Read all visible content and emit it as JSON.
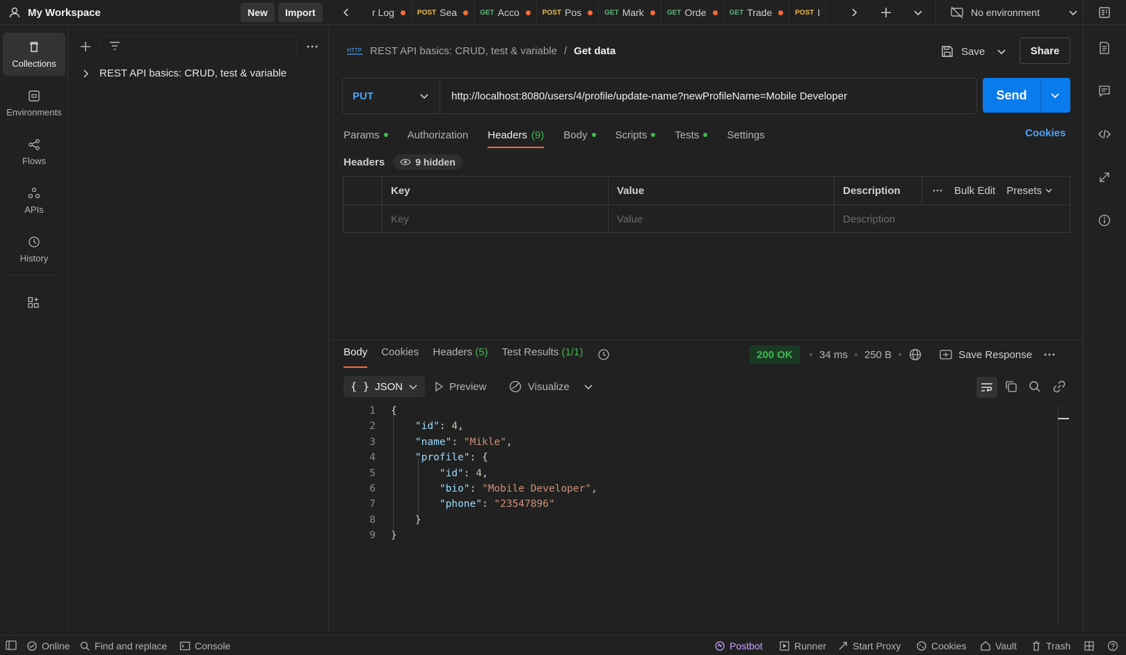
{
  "workspace": {
    "title": "My Workspace",
    "new_label": "New",
    "import_label": "Import"
  },
  "tabs": [
    {
      "method": "",
      "label": "r Log",
      "kind": "post"
    },
    {
      "method": "POST",
      "label": "Sea",
      "kind": "post"
    },
    {
      "method": "GET",
      "label": "Acco",
      "kind": "get"
    },
    {
      "method": "POST",
      "label": "Pos",
      "kind": "post"
    },
    {
      "method": "GET",
      "label": "Mark",
      "kind": "get"
    },
    {
      "method": "GET",
      "label": "Orde",
      "kind": "get"
    },
    {
      "method": "GET",
      "label": "Trade",
      "kind": "get"
    },
    {
      "method": "POST",
      "label": "I",
      "kind": "post"
    }
  ],
  "environment": {
    "label": "No environment"
  },
  "nav": [
    {
      "label": "Collections",
      "icon": "trash-can-icon"
    },
    {
      "label": "Environments",
      "icon": "environment-icon"
    },
    {
      "label": "Flows",
      "icon": "flows-icon"
    },
    {
      "label": "APIs",
      "icon": "apis-icon"
    },
    {
      "label": "History",
      "icon": "history-icon"
    }
  ],
  "sidebar": {
    "collection": "REST API basics: CRUD, test & variable"
  },
  "request": {
    "breadcrumb_parent": "REST API basics: CRUD, test & variable",
    "breadcrumb_sep": "/",
    "name": "Get data",
    "save_label": "Save",
    "share_label": "Share",
    "method": "PUT",
    "url": "http://localhost:8080/users/4/profile/update-name?newProfileName=Mobile Developer",
    "send_label": "Send",
    "tabs": {
      "params": "Params",
      "authorization": "Authorization",
      "headers": "Headers",
      "headers_count": "(9)",
      "body": "Body",
      "scripts": "Scripts",
      "tests": "Tests",
      "settings": "Settings",
      "cookies": "Cookies"
    },
    "headers_section": {
      "title": "Headers",
      "hidden": "9 hidden",
      "col_key": "Key",
      "col_value": "Value",
      "col_description": "Description",
      "bulk_edit": "Bulk Edit",
      "presets": "Presets",
      "ph_key": "Key",
      "ph_value": "Value",
      "ph_description": "Description"
    }
  },
  "response": {
    "tabs": {
      "body": "Body",
      "cookies": "Cookies",
      "headers": "Headers",
      "headers_count": "(5)",
      "test_results": "Test Results",
      "test_count": "(1/1)"
    },
    "status": "200 OK",
    "time": "34 ms",
    "size": "250 B",
    "save_response": "Save Response",
    "format": "JSON",
    "preview": "Preview",
    "visualize": "Visualize",
    "lines": [
      "1",
      "2",
      "3",
      "4",
      "5",
      "6",
      "7",
      "8",
      "9"
    ],
    "body": {
      "id_key": "\"id\"",
      "id_val": "4",
      "name_key": "\"name\"",
      "name_val": "\"Mikle\"",
      "profile_key": "\"profile\"",
      "p_id_key": "\"id\"",
      "p_id_val": "4",
      "bio_key": "\"bio\"",
      "bio_val": "\"Mobile Developer\"",
      "phone_key": "\"phone\"",
      "phone_val": "\"23547896\""
    }
  },
  "statusbar": {
    "online": "Online",
    "find_replace": "Find and replace",
    "console": "Console",
    "postbot": "Postbot",
    "runner": "Runner",
    "start_proxy": "Start Proxy",
    "cookies": "Cookies",
    "vault": "Vault",
    "trash": "Trash"
  },
  "colors": {
    "accent": "#ff6c37",
    "send": "#097bed",
    "ok": "#3fb950",
    "postbot": "#c7a3ff"
  }
}
